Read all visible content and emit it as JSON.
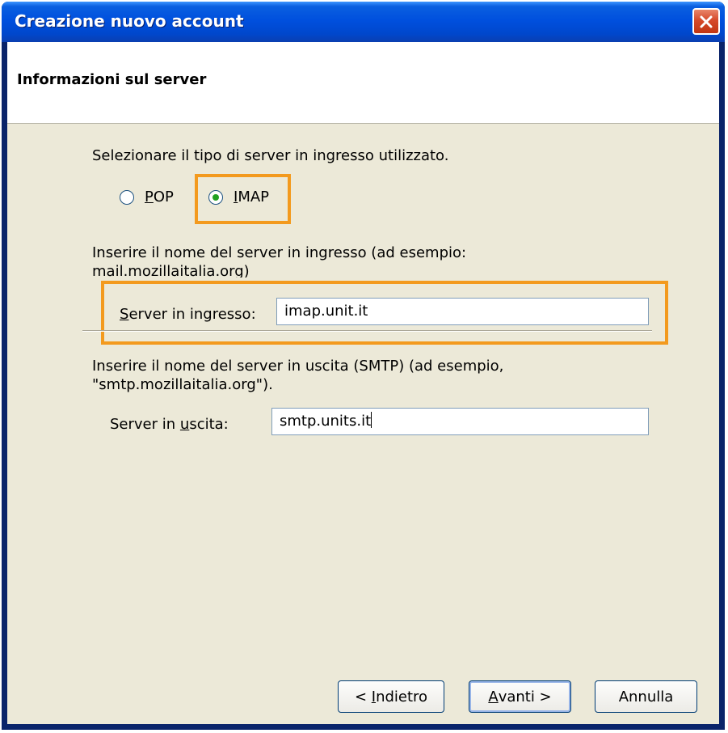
{
  "window": {
    "title": "Creazione nuovo account"
  },
  "header": {
    "title": "Informazioni sul server"
  },
  "server_type": {
    "prompt": "Selezionare il tipo di server in ingresso utilizzato.",
    "options": [
      {
        "label_underlined": "P",
        "label_rest": "OP",
        "selected": false
      },
      {
        "label_underlined": "I",
        "label_rest": "MAP",
        "selected": true
      }
    ]
  },
  "incoming": {
    "description_line1": "Inserire il nome del server in ingresso (ad esempio:",
    "description_line2": "mail.mozillaitalia.org)",
    "label_underlined": "S",
    "label_rest": "erver in ingresso:",
    "value": "imap.unit.it"
  },
  "outgoing": {
    "description_line1": "Inserire il nome del server in uscita (SMTP) (ad esempio,",
    "description_line2": "\"smtp.mozillaitalia.org\").",
    "label_before": "Server in ",
    "label_underlined": "u",
    "label_after": "scita:",
    "value": "smtp.units.it"
  },
  "buttons": {
    "back": {
      "prefix": "< ",
      "underlined": "I",
      "rest": "ndietro"
    },
    "next": {
      "underlined": "A",
      "rest": "vanti >"
    },
    "cancel": {
      "label": "Annulla"
    }
  },
  "colors": {
    "highlight": "#f39a1e",
    "titlebar": "#0050de",
    "dialog_bg": "#ece9d8"
  },
  "icons": {
    "close": "close-icon"
  }
}
